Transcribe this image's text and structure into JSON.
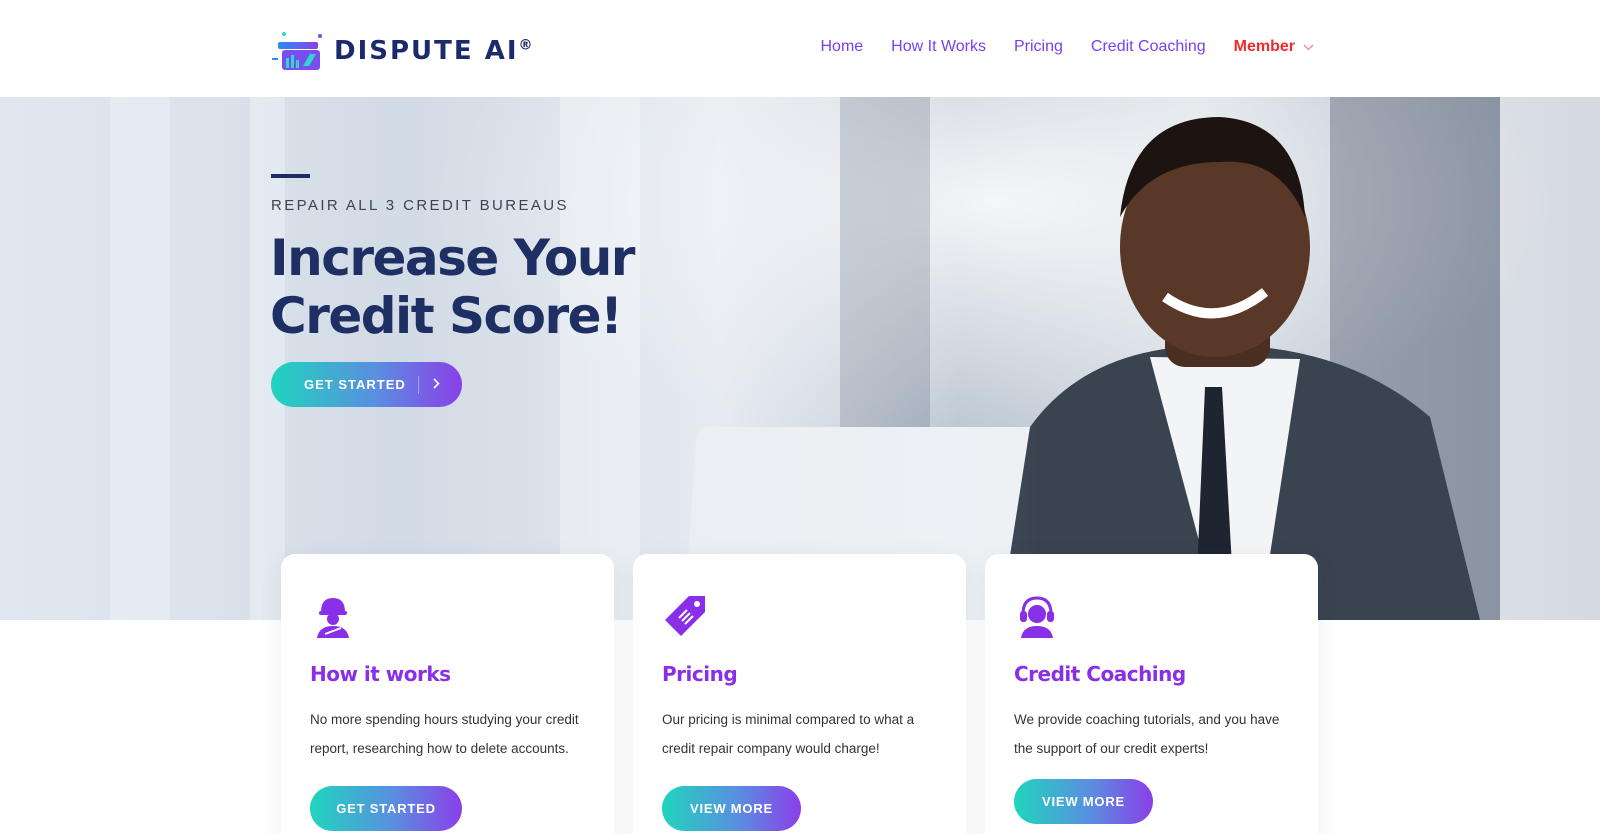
{
  "logo": {
    "text": "DISPUTE AI",
    "mark": "®"
  },
  "nav": {
    "items": [
      {
        "label": "Home"
      },
      {
        "label": "How It Works"
      },
      {
        "label": "Pricing"
      },
      {
        "label": "Credit Coaching"
      }
    ],
    "member_label": "Member",
    "member_icon": "chevron-down-icon"
  },
  "hero": {
    "kicker": "REPAIR ALL 3 CREDIT BUREAUS",
    "title": "Increase Your Credit Score!",
    "button_label": "GET STARTED",
    "button_icon": "chevron-right-icon"
  },
  "cards": [
    {
      "icon": "worker-helmet-icon",
      "title": "How it works",
      "description": "No more spending hours studying your credit report, researching how to delete accounts.",
      "button_label": "GET STARTED"
    },
    {
      "icon": "price-tag-icon",
      "title": "Pricing",
      "description": "Our pricing is minimal compared to what a credit repair company would charge!",
      "button_label": "VIEW MORE"
    },
    {
      "icon": "headset-support-icon",
      "title": "Credit Coaching",
      "description": "We provide coaching tutorials, and you have the support of our credit experts!",
      "button_label": "VIEW MORE"
    }
  ],
  "colors": {
    "accent_purple": "#8a2fe8",
    "nav_purple": "#7a3ff0",
    "member_red": "#ef2b2b",
    "navy": "#1e2f63",
    "gradient_start": "#1fd5bd",
    "gradient_end": "#8a3fe8"
  }
}
